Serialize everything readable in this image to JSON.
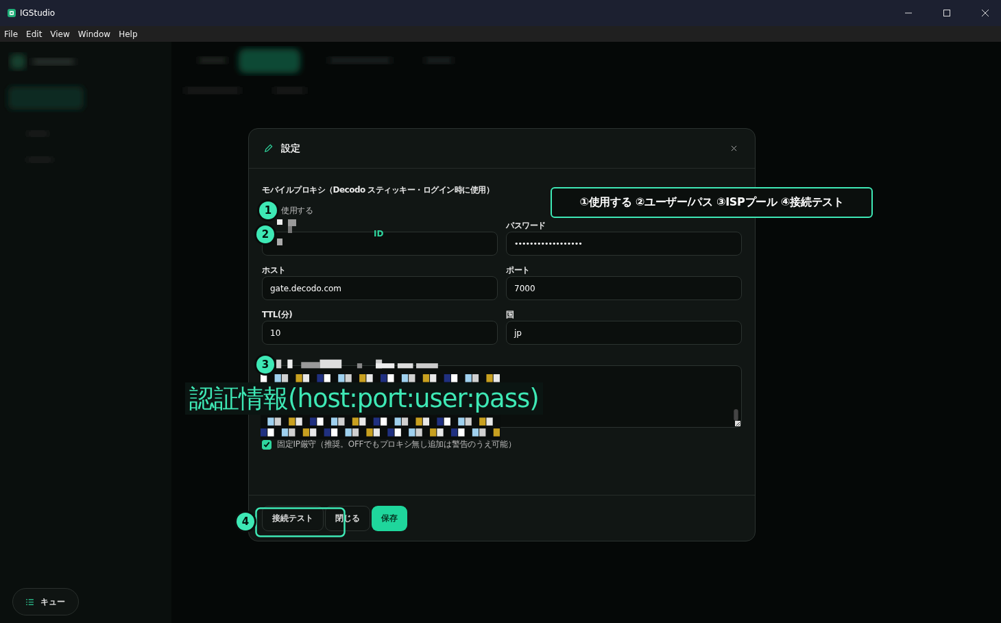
{
  "window": {
    "title": "IGStudio"
  },
  "menu": [
    "File",
    "Edit",
    "View",
    "Window",
    "Help"
  ],
  "queue_button": {
    "label": "キュー"
  },
  "dialog": {
    "title": "設定",
    "section_title": "モバイルプロキシ（Decodo スティッキー・ログイン時に使用）",
    "use_proxy": {
      "label": "使用する"
    },
    "fields": [
      {
        "kind": "redacted"
      },
      {
        "kind": "password",
        "label": "パスワード",
        "value": "••••••••••••••••••"
      },
      {
        "kind": "text",
        "label": "ホスト",
        "value": "gate.decodo.com"
      },
      {
        "kind": "text",
        "label": "ポート",
        "value": "7000"
      },
      {
        "kind": "text",
        "label": "TTL(分)",
        "value": "10"
      },
      {
        "kind": "text",
        "label": "国",
        "value": "jp"
      },
      {
        "kind": "redacted_textarea"
      }
    ],
    "strict_ip": {
      "label": "固定IP厳守（推奨。OFFでもプロキシ無し追加は警告のうえ可能）",
      "checked": true
    },
    "buttons": [
      {
        "label": "接続テスト",
        "kind": "secondary"
      },
      {
        "label": "閉じる",
        "kind": "secondary"
      },
      {
        "label": "保存",
        "kind": "primary"
      }
    ]
  },
  "annotations": {
    "callout": "①使用する ②ユーザー/パス ③ISPプール ④接続テスト",
    "badges": [
      "1",
      "2",
      "3",
      "4"
    ],
    "id_label": "ID",
    "caption": "認証情報(host:port:user:pass)"
  }
}
